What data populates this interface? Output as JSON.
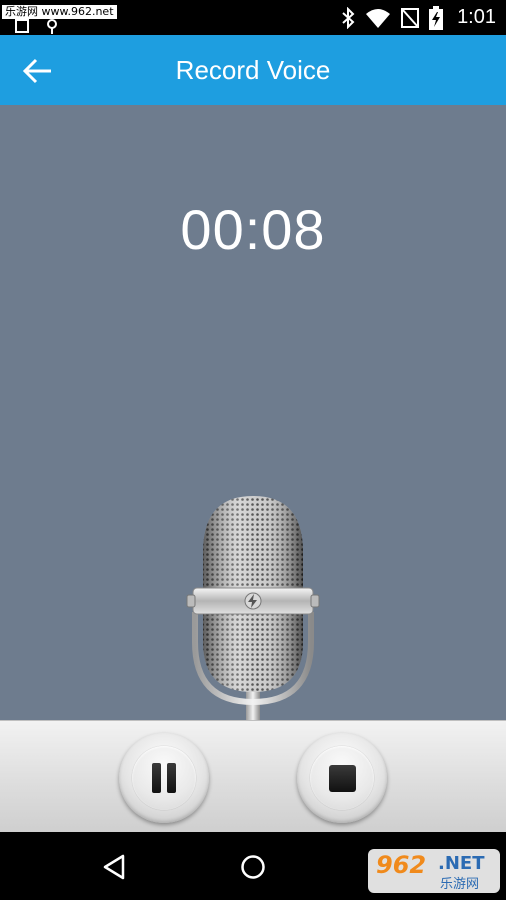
{
  "status_bar": {
    "watermark": "乐游网 www.962.net",
    "time": "1:01",
    "icons": [
      "screenshot-icon",
      "debug-icon",
      "bluetooth-icon",
      "wifi-icon",
      "no-sim-icon",
      "battery-charging-icon"
    ]
  },
  "app_bar": {
    "title": "Record Voice",
    "back_icon": "arrow-back-icon",
    "color": "#1e9ee0"
  },
  "recorder": {
    "elapsed": "00:08",
    "background": "#6e7c8e"
  },
  "controls": {
    "pause_icon": "pause-icon",
    "stop_icon": "stop-icon"
  },
  "nav_bar": {
    "back_icon": "nav-back-icon",
    "home_icon": "nav-home-icon"
  },
  "corner_watermark": {
    "number": "962",
    "suffix": ".NET",
    "chinese": "乐游网"
  }
}
